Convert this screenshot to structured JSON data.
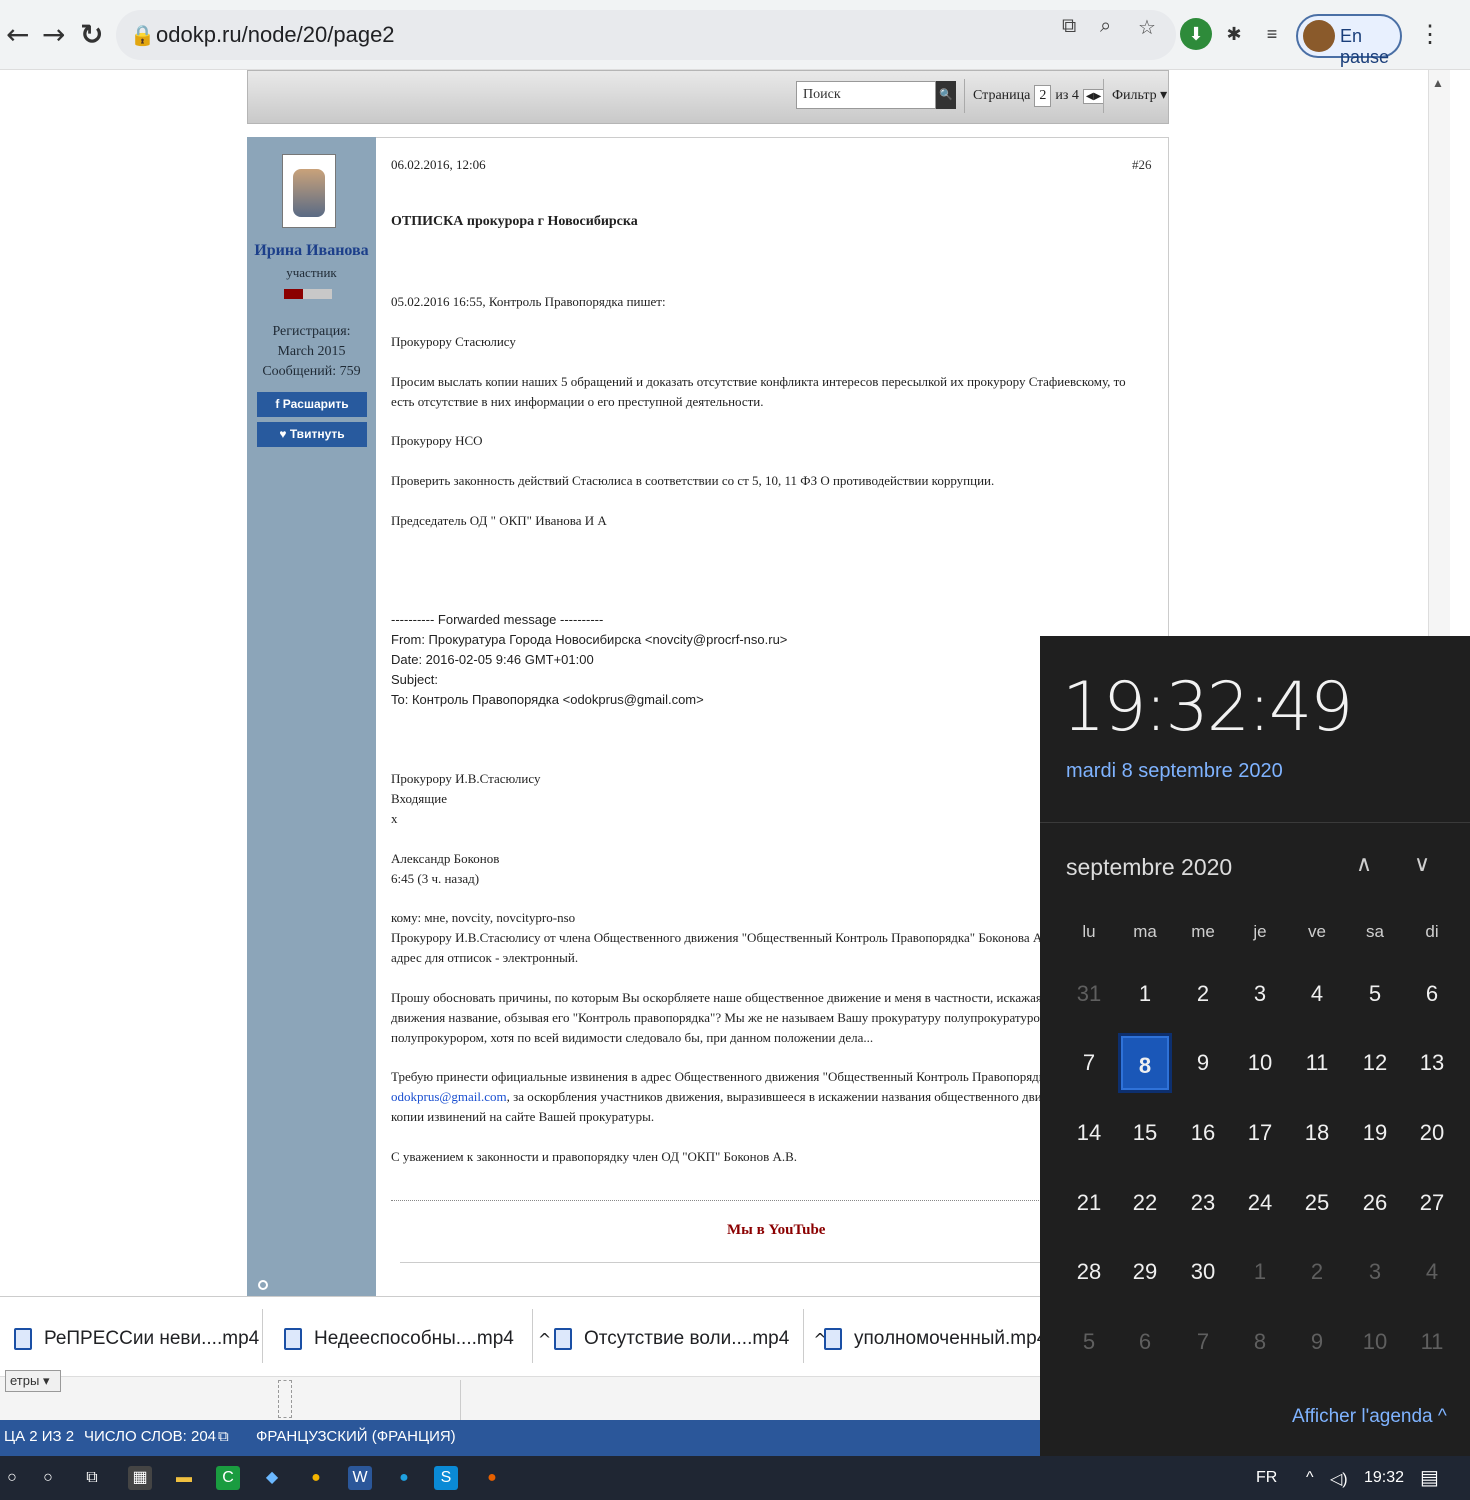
{
  "browser": {
    "url": "odokp.ru/node/20/page2",
    "profile_label": "En pause"
  },
  "forum": {
    "search_placeholder": "Поиск",
    "page_label": "Страница",
    "page_current": "2",
    "page_of": "из 4",
    "filter_label": "Фильтр ▾"
  },
  "post": {
    "timestamp": "06.02.2016, 12:06",
    "number": "#26",
    "author": "Ирина Иванова",
    "rank": "участник",
    "reg_label": "Регистрация:",
    "reg_date": "March 2015",
    "messages": "Сообщений: 759",
    "share_fb": "Расшарить",
    "share_tw": "Твитнуть",
    "title": "ОТПИСКА прокурора г Новосибирска",
    "lines": [
      "05.02.2016 16:55, Контроль Правопорядка пишет:",
      "Прокурору Стасюлису",
      "Просим выслать копии наших 5 обращений и доказать отсутствие конфликта интересов пересылкой их прокурору Стафиевскому, то есть отсутствие в них информации о его преступной деятельности.",
      "Прокурору НСО",
      "Проверить законность действий Стасюлиса в соответствии со ст 5, 10, 11 ФЗ О противодействии коррупции.",
      "Председатель ОД \" ОКП\" Иванова И А"
    ],
    "fwd": [
      "---------- Forwarded message ----------",
      "From: Прокуратура Города Новосибирска <novcity@procrf-nso.ru>",
      "Date: 2016-02-05 9:46 GMT+01:00",
      "Subject:",
      "To: Контроль Правопорядка <odokprus@gmail.com>"
    ],
    "body2": [
      "Прокурору И.В.Стасюлису",
      "Входящие",
      "x",
      "Александр Боконов",
      "6:45 (3 ч. назад)",
      "кому: мне, novcity, novcitypro-nso",
      "Прокурору И.В.Стасюлису от члена Общественного движения \"Общественный Контроль Правопорядка\" Боконова Александра",
      "адрес для отписок - электронный.",
      "Прошу обосновать причины, по которым Вы оскорбляете наше общественное движение и меня в частности, искажая избранное",
      "движения название, обзывая его \"Контроль правопорядка\"? Мы же не называем Вашу прокуратуру полупрокуратурой и не В",
      "полупрокурором, хотя по всей видимости следовало бы, при данном положении дела...",
      "Требую принести официальные извинения в адрес Общественного движения \"Общественный Контроль Правопорядка\" на а",
      "odokprus@gmail.com",
      ", за оскорбления участников движения, выразившееся в искажении названия общественного движения",
      "копии извинений на сайте Вашей прокуратуры.",
      "С уважением к законности и правопорядку член ОД \"ОКП\" Боконов А.В."
    ],
    "youtube": "Мы в YouTube"
  },
  "downloads": [
    "РеПРЕССии неви....mp4",
    "Недееспособны....mp4",
    "Отсутствие воли....mp4",
    "уполномоченный.mp4"
  ],
  "word": {
    "filter_stub": "етры ▾",
    "page_status": "ЦА 2 ИЗ 2",
    "word_count": "ЧИСЛО СЛОВ: 204",
    "language": "ФРАНЦУЗСКИЙ (ФРАНЦИЯ)"
  },
  "taskbar": {
    "lang": "FR",
    "time": "19:32"
  },
  "calendar": {
    "clock": "19:32:49",
    "full_date": "mardi 8 septembre 2020",
    "month_label": "septembre 2020",
    "weekdays": [
      "lu",
      "ma",
      "me",
      "je",
      "ve",
      "sa",
      "di"
    ],
    "weeks": [
      [
        "31",
        "1",
        "2",
        "3",
        "4",
        "5",
        "6"
      ],
      [
        "7",
        "8",
        "9",
        "10",
        "11",
        "12",
        "13"
      ],
      [
        "14",
        "15",
        "16",
        "17",
        "18",
        "19",
        "20"
      ],
      [
        "21",
        "22",
        "23",
        "24",
        "25",
        "26",
        "27"
      ],
      [
        "28",
        "29",
        "30",
        "1",
        "2",
        "3",
        "4"
      ],
      [
        "5",
        "6",
        "7",
        "8",
        "9",
        "10",
        "11"
      ]
    ],
    "today": "8",
    "agenda_label": "Afficher l'agenda ^"
  }
}
